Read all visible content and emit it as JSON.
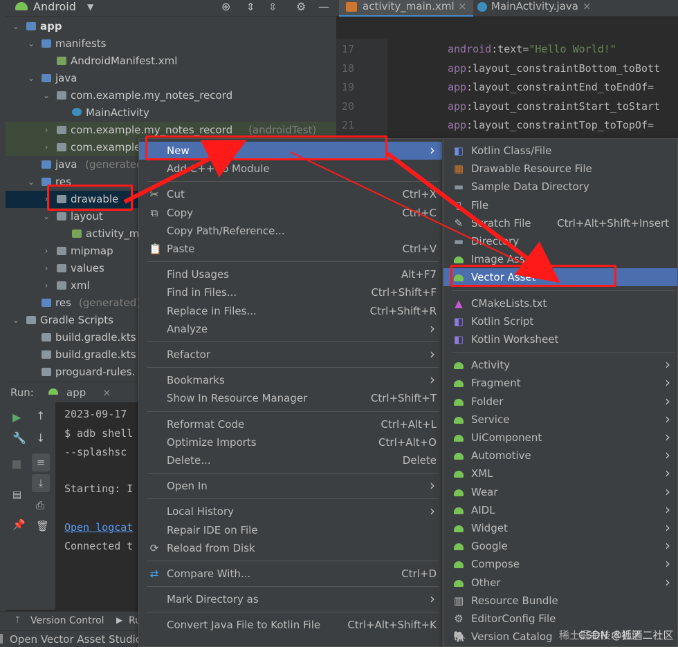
{
  "project_panel": {
    "view_selector": "Android",
    "tree": [
      {
        "label": "app",
        "level": 0,
        "bold": true
      },
      {
        "label": "manifests",
        "level": 1
      },
      {
        "label": "AndroidManifest.xml",
        "level": 2
      },
      {
        "label": "java",
        "level": 1
      },
      {
        "label": "com.example.my_notes_record",
        "level": 2
      },
      {
        "label": "MainActivity",
        "level": 3
      },
      {
        "label": "com.example.my_notes_record",
        "secondary": "(androidTest)",
        "level": 2
      },
      {
        "label": "com.example",
        "level": 2
      },
      {
        "label": "java",
        "secondary": "(generated)",
        "level": 1
      },
      {
        "label": "res",
        "level": 1
      },
      {
        "label": "drawable",
        "level": 2,
        "selected": true
      },
      {
        "label": "layout",
        "level": 2
      },
      {
        "label": "activity_m",
        "level": 3
      },
      {
        "label": "mipmap",
        "level": 2
      },
      {
        "label": "values",
        "level": 2
      },
      {
        "label": "xml",
        "level": 2
      },
      {
        "label": "res",
        "secondary": "(generated)",
        "level": 1
      },
      {
        "label": "Gradle Scripts",
        "level": 0
      },
      {
        "label": "build.gradle.kts",
        "level": 1
      },
      {
        "label": "build.gradle.kts",
        "level": 1
      },
      {
        "label": "proguard-rules.",
        "level": 1
      }
    ]
  },
  "editor": {
    "tabs": [
      {
        "label": "activity_main.xml",
        "active": true
      },
      {
        "label": "MainActivity.java",
        "active": false
      }
    ],
    "lines": [
      {
        "num": "17",
        "ns": "android",
        "attr": ":text=",
        "val": "\"Hello World!\""
      },
      {
        "num": "18",
        "ns": "app",
        "attr": ":layout_constraintBottom_toBott",
        "val": ""
      },
      {
        "num": "19",
        "ns": "app",
        "attr": ":layout_constraintEnd_toEndOf=",
        "val": ""
      },
      {
        "num": "20",
        "ns": "app",
        "attr": ":layout_constraintStart_toStart",
        "val": ""
      },
      {
        "num": "21",
        "ns": "app",
        "attr": ":layout_constraintTop_toTopOf=",
        "val": ""
      }
    ]
  },
  "run_panel": {
    "label": "Run:",
    "config": "app",
    "console": [
      {
        "text": "2023-09-17",
        "link": false
      },
      {
        "text": "$ adb shell",
        "link": false
      },
      {
        "text": " --splashsc",
        "link": false
      },
      {
        "text": "",
        "link": false
      },
      {
        "text": "Starting: I",
        "link": false
      },
      {
        "text": "",
        "link": false
      },
      {
        "text": "Open logcat",
        "link": true
      },
      {
        "text": "Connected t",
        "link": false
      }
    ]
  },
  "bottom_tabs": [
    "Version Control",
    "Ru"
  ],
  "status_text": "Open Vector Asset Studio",
  "context_menu": {
    "items": [
      {
        "type": "item",
        "label": "New",
        "shortcut": "",
        "submenu": true,
        "selected": true
      },
      {
        "type": "item",
        "label": "Add C++ to Module",
        "shortcut": ""
      },
      {
        "type": "sep"
      },
      {
        "type": "item",
        "label": "Cut",
        "shortcut": "Ctrl+X",
        "icon": "cut-icon"
      },
      {
        "type": "item",
        "label": "Copy",
        "shortcut": "Ctrl+C",
        "icon": "copy-icon"
      },
      {
        "type": "item",
        "label": "Copy Path/Reference...",
        "shortcut": ""
      },
      {
        "type": "item",
        "label": "Paste",
        "shortcut": "Ctrl+V",
        "icon": "paste-icon"
      },
      {
        "type": "sep"
      },
      {
        "type": "item",
        "label": "Find Usages",
        "shortcut": "Alt+F7"
      },
      {
        "type": "item",
        "label": "Find in Files...",
        "shortcut": "Ctrl+Shift+F"
      },
      {
        "type": "item",
        "label": "Replace in Files...",
        "shortcut": "Ctrl+Shift+R"
      },
      {
        "type": "item",
        "label": "Analyze",
        "shortcut": "",
        "submenu": true
      },
      {
        "type": "sep"
      },
      {
        "type": "item",
        "label": "Refactor",
        "shortcut": "",
        "submenu": true
      },
      {
        "type": "sep"
      },
      {
        "type": "item",
        "label": "Bookmarks",
        "shortcut": "",
        "submenu": true
      },
      {
        "type": "item",
        "label": "Show In Resource Manager",
        "shortcut": "Ctrl+Shift+T"
      },
      {
        "type": "sep"
      },
      {
        "type": "item",
        "label": "Reformat Code",
        "shortcut": "Ctrl+Alt+L"
      },
      {
        "type": "item",
        "label": "Optimize Imports",
        "shortcut": "Ctrl+Alt+O"
      },
      {
        "type": "item",
        "label": "Delete...",
        "shortcut": "Delete"
      },
      {
        "type": "sep"
      },
      {
        "type": "item",
        "label": "Open In",
        "shortcut": "",
        "submenu": true
      },
      {
        "type": "sep"
      },
      {
        "type": "item",
        "label": "Local History",
        "shortcut": "",
        "submenu": true
      },
      {
        "type": "item",
        "label": "Repair IDE on File",
        "shortcut": ""
      },
      {
        "type": "item",
        "label": "Reload from Disk",
        "shortcut": "",
        "icon": "reload-icon"
      },
      {
        "type": "sep"
      },
      {
        "type": "item",
        "label": "Compare With...",
        "shortcut": "Ctrl+D",
        "icon": "compare-icon"
      },
      {
        "type": "sep"
      },
      {
        "type": "item",
        "label": "Mark Directory as",
        "shortcut": "",
        "submenu": true
      },
      {
        "type": "sep"
      },
      {
        "type": "item",
        "label": "Convert Java File to Kotlin File",
        "shortcut": "Ctrl+Alt+Shift+K"
      }
    ]
  },
  "new_submenu": {
    "items": [
      {
        "type": "item",
        "label": "Kotlin Class/File",
        "icon": "kotlin-class-icon"
      },
      {
        "type": "item",
        "label": "Drawable Resource File",
        "icon": "drawable-file-icon"
      },
      {
        "type": "item",
        "label": "Sample Data Directory",
        "icon": "folder-icon"
      },
      {
        "type": "item",
        "label": "File",
        "icon": "file-icon"
      },
      {
        "type": "item",
        "label": "Scratch File",
        "shortcut": "Ctrl+Alt+Shift+Insert",
        "icon": "scratch-file-icon"
      },
      {
        "type": "item",
        "label": "Directory",
        "icon": "folder-icon"
      },
      {
        "type": "item",
        "label": "Image Asset",
        "icon": "android-icon"
      },
      {
        "type": "item",
        "label": "Vector Asset",
        "icon": "android-icon",
        "selected": true
      },
      {
        "type": "sep"
      },
      {
        "type": "item",
        "label": "CMakeLists.txt",
        "icon": "cmake-icon"
      },
      {
        "type": "item",
        "label": "Kotlin Script",
        "icon": "kotlin-script-icon"
      },
      {
        "type": "item",
        "label": "Kotlin Worksheet",
        "icon": "kotlin-script-icon"
      },
      {
        "type": "sep"
      },
      {
        "type": "item",
        "label": "Activity",
        "submenu": true,
        "icon": "android-icon"
      },
      {
        "type": "item",
        "label": "Fragment",
        "submenu": true,
        "icon": "android-icon"
      },
      {
        "type": "item",
        "label": "Folder",
        "submenu": true,
        "icon": "android-icon"
      },
      {
        "type": "item",
        "label": "Service",
        "submenu": true,
        "icon": "android-icon"
      },
      {
        "type": "item",
        "label": "UiComponent",
        "submenu": true,
        "icon": "android-icon"
      },
      {
        "type": "item",
        "label": "Automotive",
        "submenu": true,
        "icon": "android-icon"
      },
      {
        "type": "item",
        "label": "XML",
        "submenu": true,
        "icon": "android-icon"
      },
      {
        "type": "item",
        "label": "Wear",
        "submenu": true,
        "icon": "android-icon"
      },
      {
        "type": "item",
        "label": "AIDL",
        "submenu": true,
        "icon": "android-icon"
      },
      {
        "type": "item",
        "label": "Widget",
        "submenu": true,
        "icon": "android-icon"
      },
      {
        "type": "item",
        "label": "Google",
        "submenu": true,
        "icon": "android-icon"
      },
      {
        "type": "item",
        "label": "Compose",
        "submenu": true,
        "icon": "android-icon"
      },
      {
        "type": "item",
        "label": "Other",
        "submenu": true,
        "icon": "android-icon"
      },
      {
        "type": "item",
        "label": "Resource Bundle",
        "icon": "resource-bundle-icon"
      },
      {
        "type": "item",
        "label": "EditorConfig File",
        "icon": "gear-icon"
      },
      {
        "type": "item",
        "label": "Version Catalog",
        "icon": "gradle-icon"
      }
    ]
  },
  "watermark": "稀土掘金技术社区",
  "watermark2": "CSDN @狐酒二社区",
  "colors": {
    "selection": "#4b6eaf",
    "annotation": "#ff1a1a",
    "panel": "#3c3f41",
    "editor": "#2b2b2b"
  }
}
